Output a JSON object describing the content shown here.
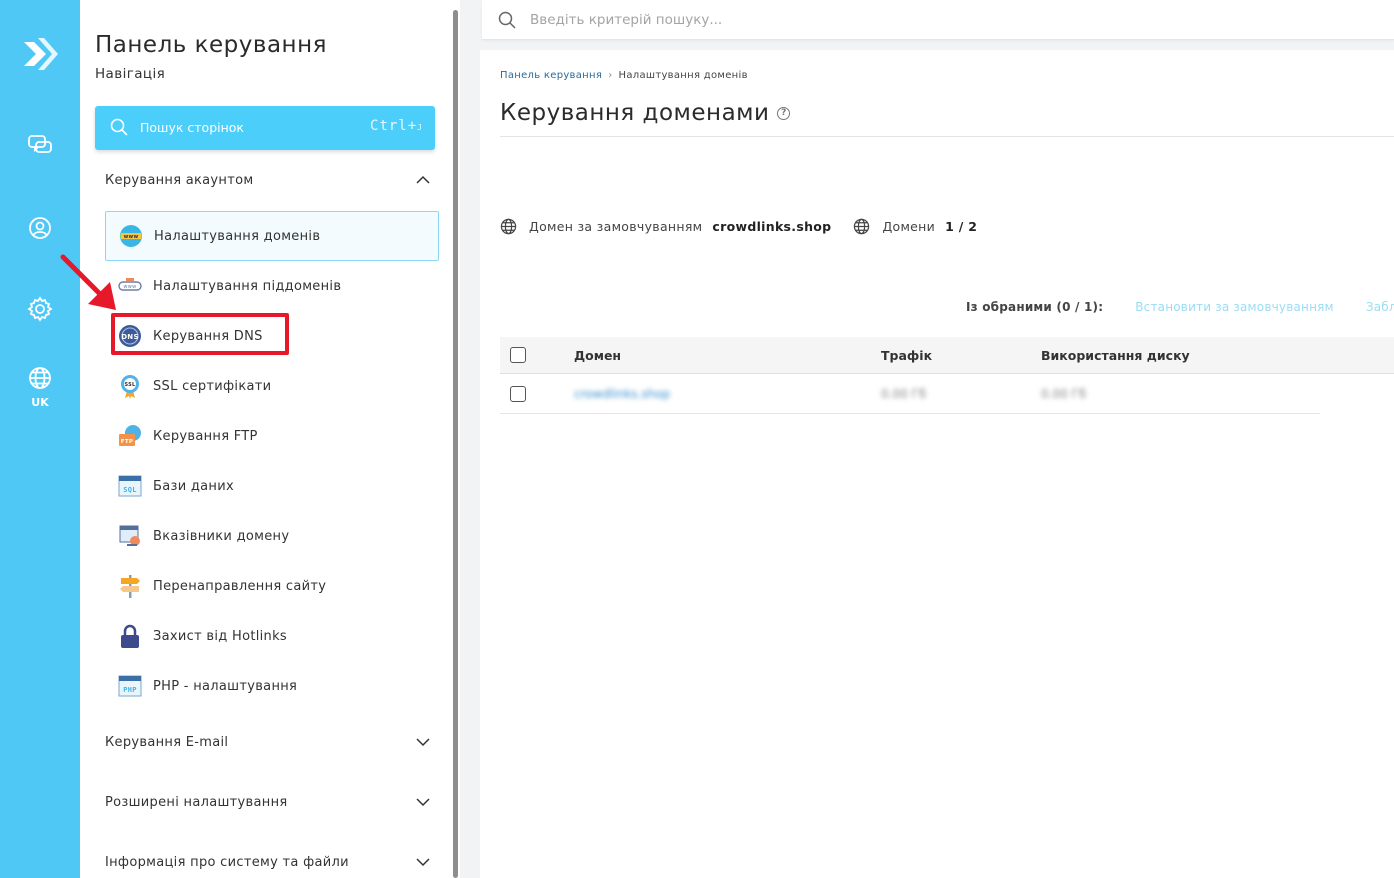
{
  "sidebar_rail": {
    "language_label": "UK",
    "icons": [
      "logo-icon",
      "chat-icon",
      "user-icon",
      "gear-icon",
      "globe-icon"
    ]
  },
  "nav": {
    "title": "Панель керування",
    "subtitle": "Навігація",
    "page_search": {
      "label": "Пошук сторінок",
      "shortcut": "Ctrl+",
      "shortcut_key": "J"
    },
    "sections": [
      {
        "label": "Керування акаунтом",
        "expanded": true,
        "items": [
          {
            "label": "Налаштування доменів",
            "icon": "www-globe-icon",
            "active": true
          },
          {
            "label": "Налаштування піддоменів",
            "icon": "subdomain-icon",
            "active": false
          },
          {
            "label": "Керування DNS",
            "icon": "dns-icon",
            "active": false,
            "highlighted": true
          },
          {
            "label": "SSL сертифікати",
            "icon": "ssl-badge-icon",
            "active": false
          },
          {
            "label": "Керування FTP",
            "icon": "ftp-folder-icon",
            "active": false
          },
          {
            "label": "Бази даних",
            "icon": "sql-database-icon",
            "active": false
          },
          {
            "label": "Вказівники домену",
            "icon": "domain-pointer-icon",
            "active": false
          },
          {
            "label": "Перенаправлення сайту",
            "icon": "signpost-icon",
            "active": false
          },
          {
            "label": "Захист від Hotlinks",
            "icon": "lock-icon",
            "active": false
          },
          {
            "label": "PHP - налаштування",
            "icon": "php-icon",
            "active": false
          }
        ]
      },
      {
        "label": "Керування E-mail",
        "expanded": false
      },
      {
        "label": "Розширені налаштування",
        "expanded": false
      },
      {
        "label": "Інформація про систему та файли",
        "expanded": false
      }
    ]
  },
  "topbar": {
    "search_placeholder": "Введіть критерій пошуку..."
  },
  "main": {
    "breadcrumb": {
      "root": "Панель керування",
      "current": "Налаштування доменів"
    },
    "title": "Керування доменами",
    "default_domain_label": "Домен за замовчуванням",
    "default_domain_value": "crowdlinks.shop",
    "domains_label": "Домени",
    "domains_value": "1 / 2",
    "bulk": {
      "selected_label": "Із обраними (0 / 1):",
      "set_default": "Встановити за замовчуванням",
      "block": "Забло"
    },
    "table": {
      "columns": [
        "Домен",
        "Трафік",
        "Використання диску"
      ],
      "rows": [
        {
          "domain": "crowdlinks.shop",
          "traffic": "0.00 Гб",
          "disk": "0.00 Гб"
        }
      ]
    }
  },
  "colors": {
    "rail": "#4fc8f6",
    "search_button": "#4ccefa",
    "highlight": "#e8182b",
    "link": "#2a6b9a"
  }
}
